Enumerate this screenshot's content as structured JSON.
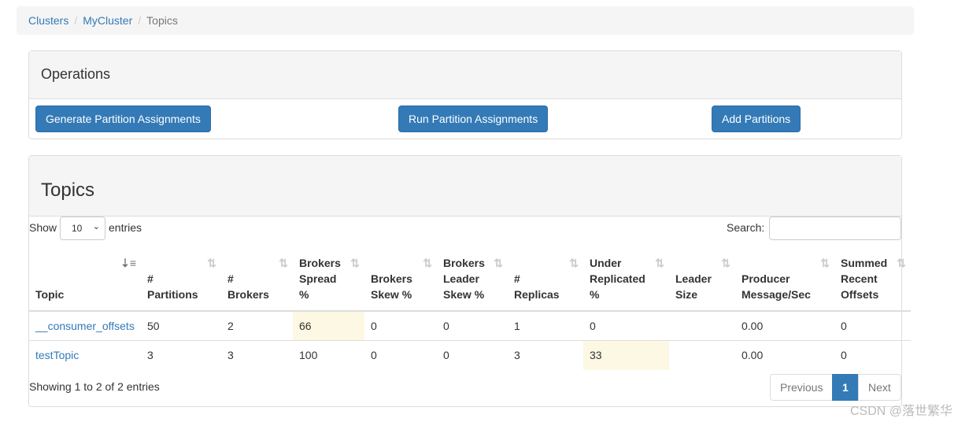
{
  "breadcrumb": [
    "Clusters",
    "MyCluster",
    "Topics"
  ],
  "operations": {
    "title": "Operations",
    "buttons": [
      "Generate Partition Assignments",
      "Run Partition Assignments",
      "Add Partitions"
    ]
  },
  "topics": {
    "title": "Topics",
    "show_label": "Show",
    "entries_label": "entries",
    "page_length": "10",
    "search_label": "Search:",
    "search_value": "",
    "columns": [
      [
        "Topic"
      ],
      [
        "#",
        "Partitions"
      ],
      [
        "#",
        "Brokers"
      ],
      [
        "Brokers",
        "Spread",
        "%"
      ],
      [
        "Brokers",
        "Skew %"
      ],
      [
        "Brokers",
        "Leader",
        "Skew %"
      ],
      [
        "#",
        "Replicas"
      ],
      [
        "Under",
        "Replicated",
        "%"
      ],
      [
        "Leader",
        "Size"
      ],
      [
        "Producer",
        "Message/Sec"
      ],
      [
        "Summed",
        "Recent",
        "Offsets"
      ]
    ],
    "rows": [
      [
        "__consumer_offsets",
        "50",
        "2",
        "66",
        "0",
        "0",
        "1",
        "0",
        "",
        "0.00",
        "0"
      ],
      [
        "testTopic",
        "3",
        "3",
        "100",
        "0",
        "0",
        "3",
        "33",
        "",
        "0.00",
        "0"
      ]
    ],
    "highlight": {
      "0": [
        3
      ],
      "1": [
        7
      ]
    },
    "info": "Showing 1 to 2 of 2 entries",
    "pagination": {
      "previous": "Previous",
      "current": "1",
      "next": "Next"
    }
  },
  "colors": {
    "primary": "#337ab7",
    "warning_cell": "#fcf8e3"
  },
  "watermark": "CSDN @落世繁华"
}
